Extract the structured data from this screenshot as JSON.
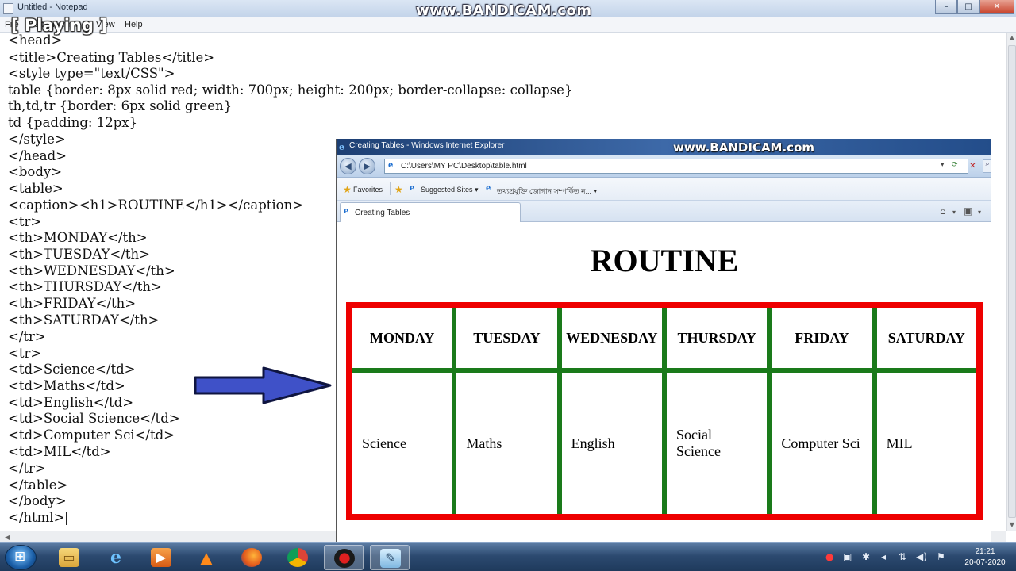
{
  "recording": {
    "watermark": "www.BANDICAM.com",
    "status": "[ Playing ]"
  },
  "notepad": {
    "title": "Untitled - Notepad",
    "menu": [
      "File",
      "Edit",
      "Format",
      "View",
      "Help"
    ],
    "lines": [
      "<head>",
      "<title>Creating Tables</title>",
      "<style type=\"text/CSS\">",
      "table {border: 8px solid red; width: 700px; height: 200px; border-collapse: collapse}",
      "th,td,tr {border: 6px solid green}",
      "td {padding: 12px}",
      "</style>",
      "</head>",
      "<body>",
      "<table>",
      "<caption><h1>ROUTINE</h1></caption>",
      "<tr>",
      "<th>MONDAY</th>",
      "<th>TUESDAY</th>",
      "<th>WEDNESDAY</th>",
      "<th>THURSDAY</th>",
      "<th>FRIDAY</th>",
      "<th>SATURDAY</th>",
      "</tr>",
      "<tr>",
      "<td>Science</td>",
      "<td>Maths</td>",
      "<td>English</td>",
      "<td>Social Science</td>",
      "<td>Computer Sci</td>",
      "<td>MIL</td>",
      "</tr>",
      "</table>",
      "</body>",
      "</html>"
    ]
  },
  "browser": {
    "title": "Creating Tables - Windows Internet Explorer",
    "address": "C:\\Users\\MY PC\\Desktop\\table.html",
    "favorites_label": "Favorites",
    "suggested_sites": "Suggested Sites",
    "bengali_link": "তথ্যপ্রযুক্তি জোগান সম্পর্কিত ন...",
    "tab_label": "Creating Tables",
    "page": {
      "caption": "ROUTINE",
      "headers": [
        "MONDAY",
        "TUESDAY",
        "WEDNESDAY",
        "THURSDAY",
        "FRIDAY",
        "SATURDAY"
      ],
      "cells": [
        "Science",
        "Maths",
        "English",
        "Social Science",
        "Computer Sci",
        "MIL"
      ]
    }
  },
  "taskbar": {
    "time": "21:21",
    "date": "20-07-2020"
  },
  "colors": {
    "table_border": "#ee0000",
    "cell_border": "#1a7a1a",
    "arrow": "#3f51c8"
  }
}
